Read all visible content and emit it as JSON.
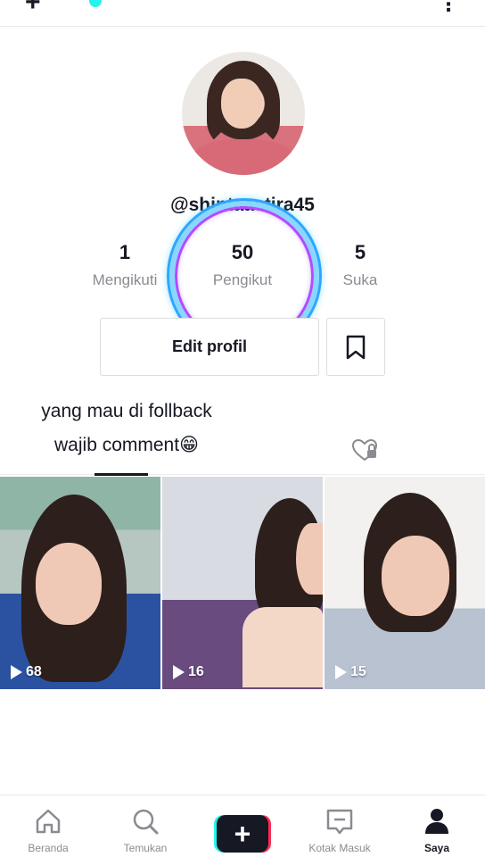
{
  "profile": {
    "username": "@shintaastira45",
    "stats": [
      {
        "value": "1",
        "label": "Mengikuti"
      },
      {
        "value": "50",
        "label": "Pengikut"
      },
      {
        "value": "5",
        "label": "Suka"
      }
    ],
    "edit_label": "Edit profil",
    "caption_line1": "yang mau di follback",
    "caption_line2": "wajib comment😁"
  },
  "videos": [
    {
      "views": "68"
    },
    {
      "views": "16"
    },
    {
      "views": "15"
    }
  ],
  "nav": [
    {
      "label": "Beranda",
      "icon": "home-icon"
    },
    {
      "label": "Temukan",
      "icon": "search-icon"
    },
    {
      "label": "",
      "icon": "plus-icon"
    },
    {
      "label": "Kotak Masuk",
      "icon": "inbox-icon"
    },
    {
      "label": "Saya",
      "icon": "profile-icon",
      "active": true
    }
  ],
  "colors": {
    "text_primary": "#161823",
    "text_secondary": "#8a8b91",
    "accent_red": "#fe2c55",
    "accent_cyan": "#25f4ee"
  }
}
